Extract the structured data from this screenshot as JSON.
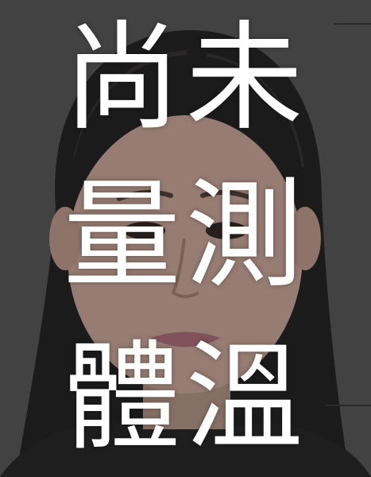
{
  "message": {
    "lines": [
      "尚未",
      "量測",
      "體溫"
    ]
  },
  "colors": {
    "text": "#ffffff",
    "background": "#4a4a4a"
  }
}
